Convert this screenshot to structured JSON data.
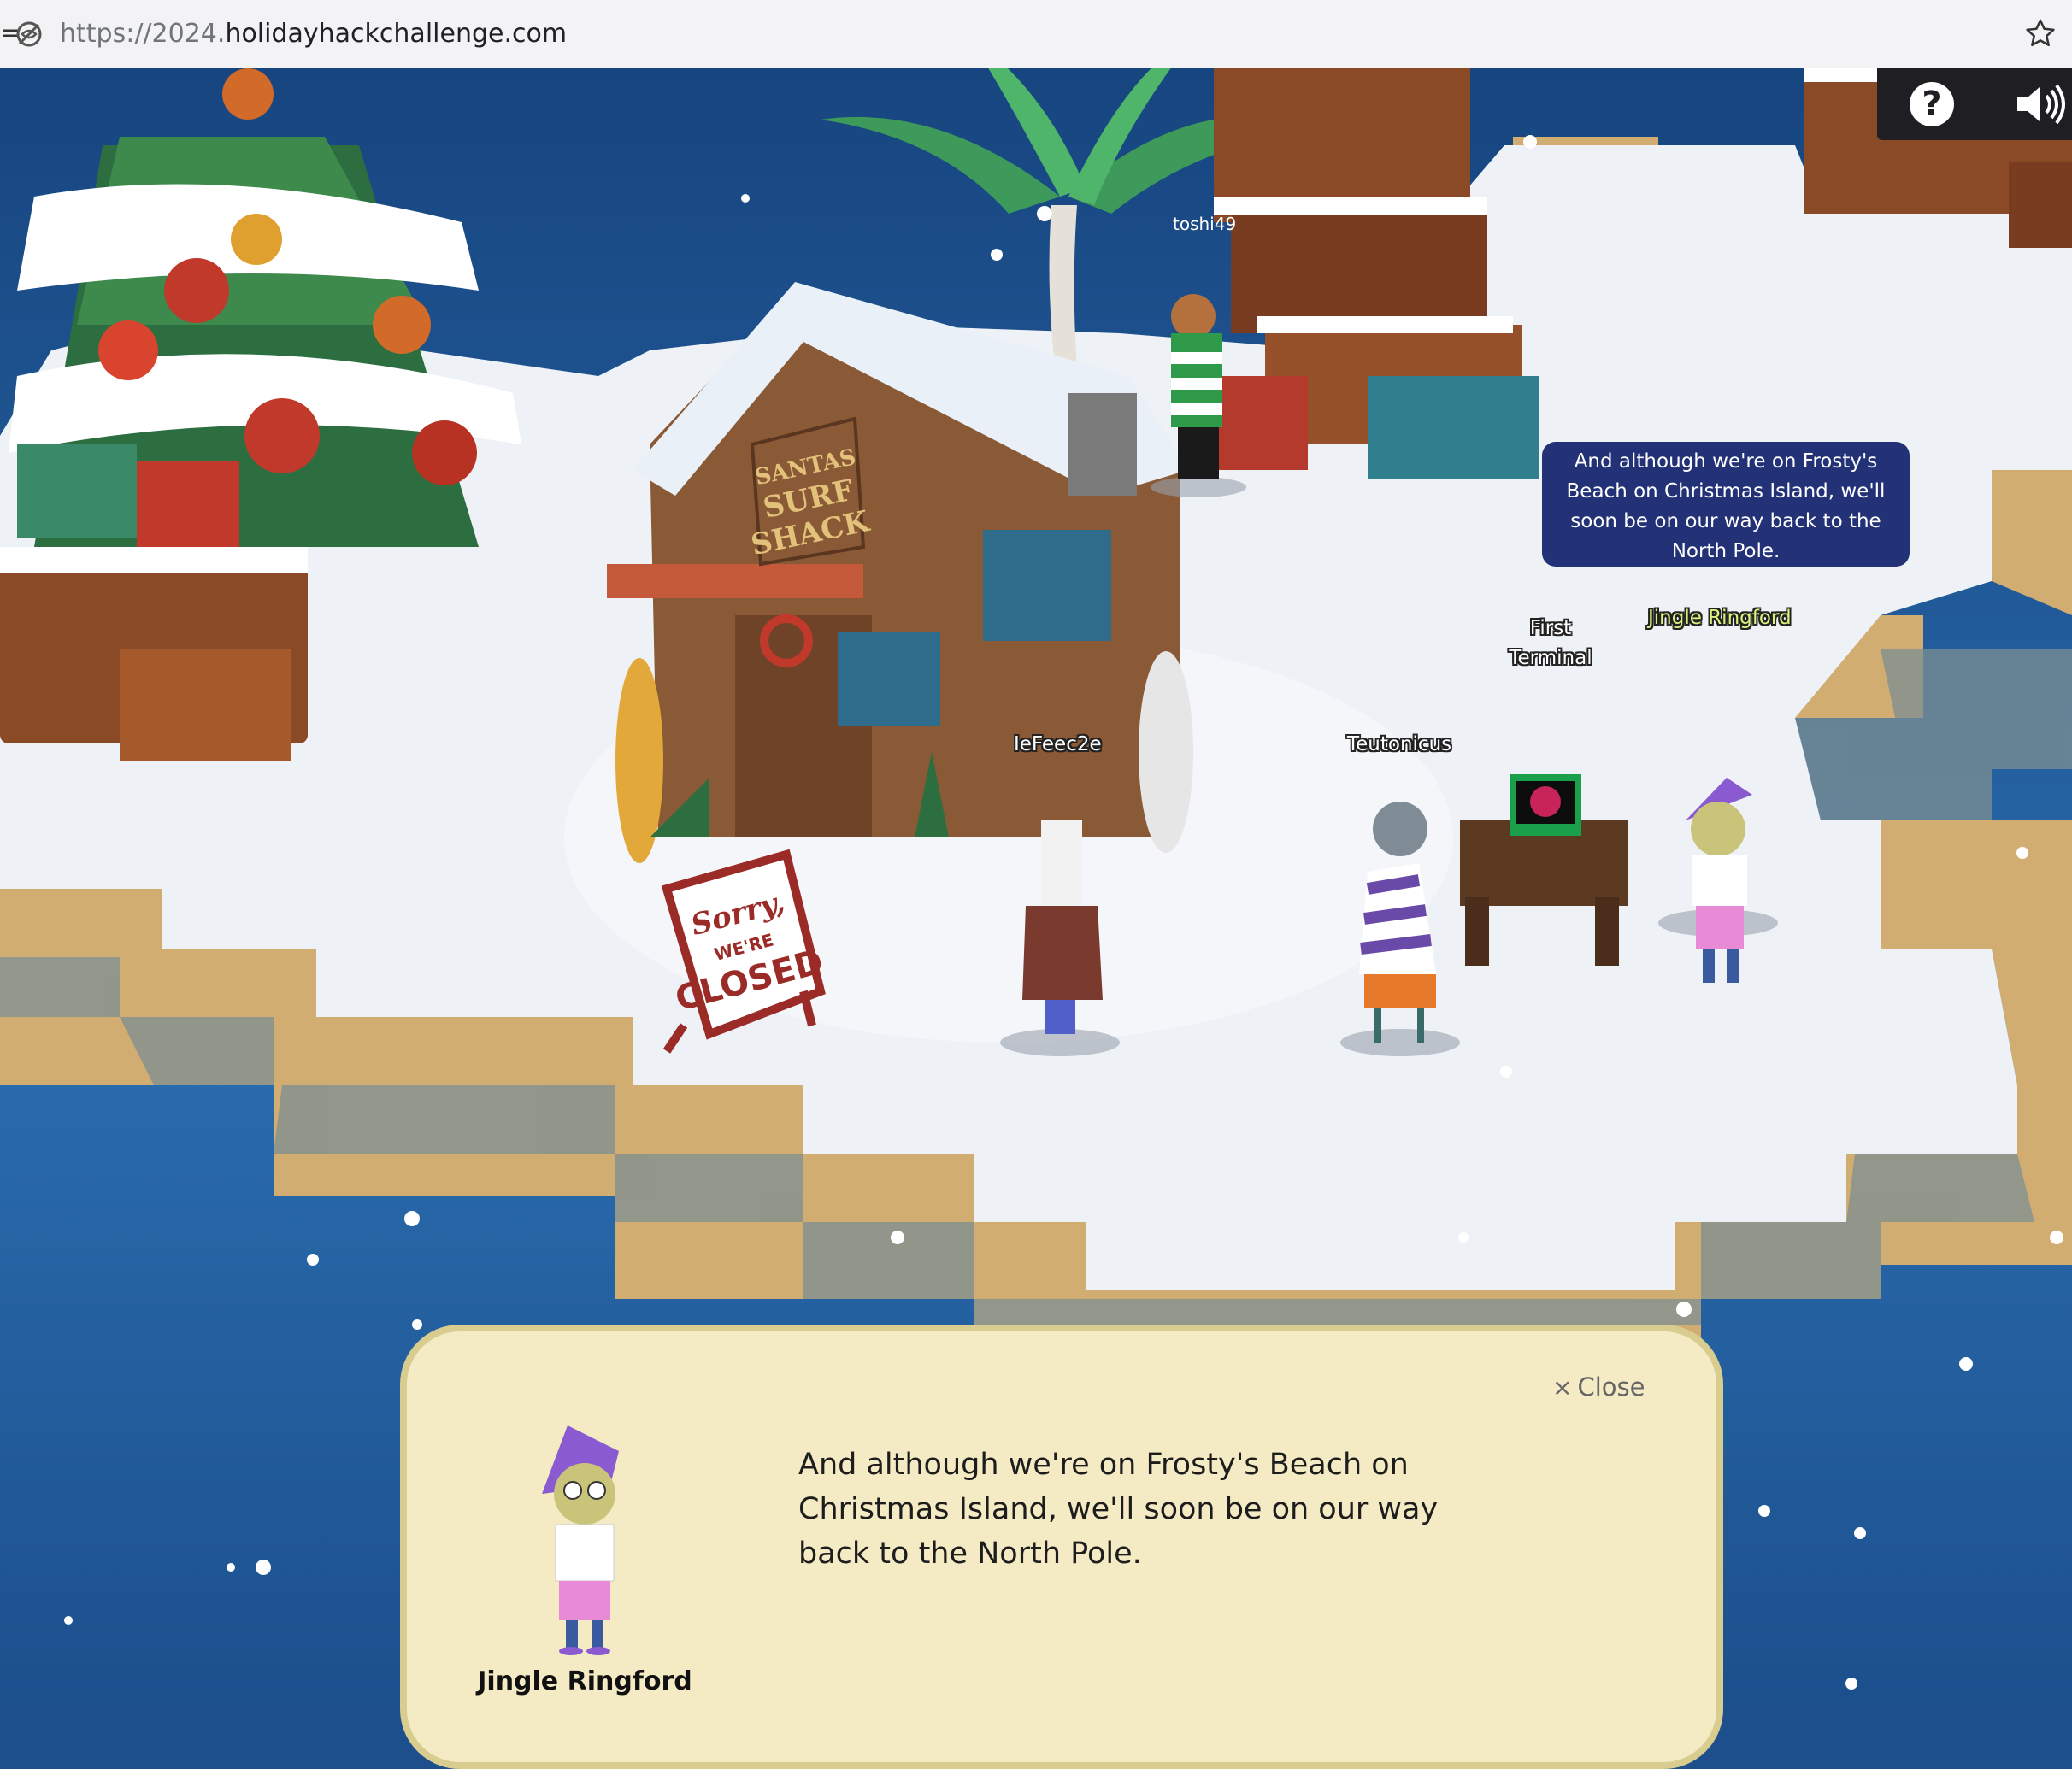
{
  "browser": {
    "url_scheme": "https://",
    "url_subdomain": "2024.",
    "url_domain": "holidayhackchallenge.com",
    "tracking_icon": "tracking-protection-icon",
    "bookmark_icon": "bookmark-star-icon"
  },
  "scene": {
    "shop_sign": [
      "SANTAS",
      "SURF",
      "SHACK"
    ],
    "closed_sign": [
      "Sorry,",
      "WE'RE",
      "CLOSED"
    ],
    "players": [
      {
        "name": "toshi49"
      },
      {
        "name": "IeFeec2e"
      },
      {
        "name": "Teutonicus"
      }
    ],
    "npc_name": "Jingle Ringford",
    "terminal_label_line1": "First",
    "terminal_label_line2": "Terminal",
    "speech_bubble": "And although we're on Frosty's Beach on Christmas Island, we'll soon be on our way back to the North Pole."
  },
  "controls": {
    "help_label": "?",
    "help_icon": "help-icon",
    "sound_icon": "speaker-icon"
  },
  "dialog": {
    "close_label": "Close",
    "close_icon": "close-icon",
    "text": "And although we're on Frosty's Beach on Christmas Island, we'll soon be on our way back to the North Pole.",
    "speaker_name": "Jingle Ringford"
  },
  "colors": {
    "ocean": "#1c4f8c",
    "snow": "#eef2f7",
    "sand": "#d2ad72",
    "bubble": "#233276",
    "dialog_bg": "#f4eac3",
    "npc_name": "#d9f37c"
  }
}
